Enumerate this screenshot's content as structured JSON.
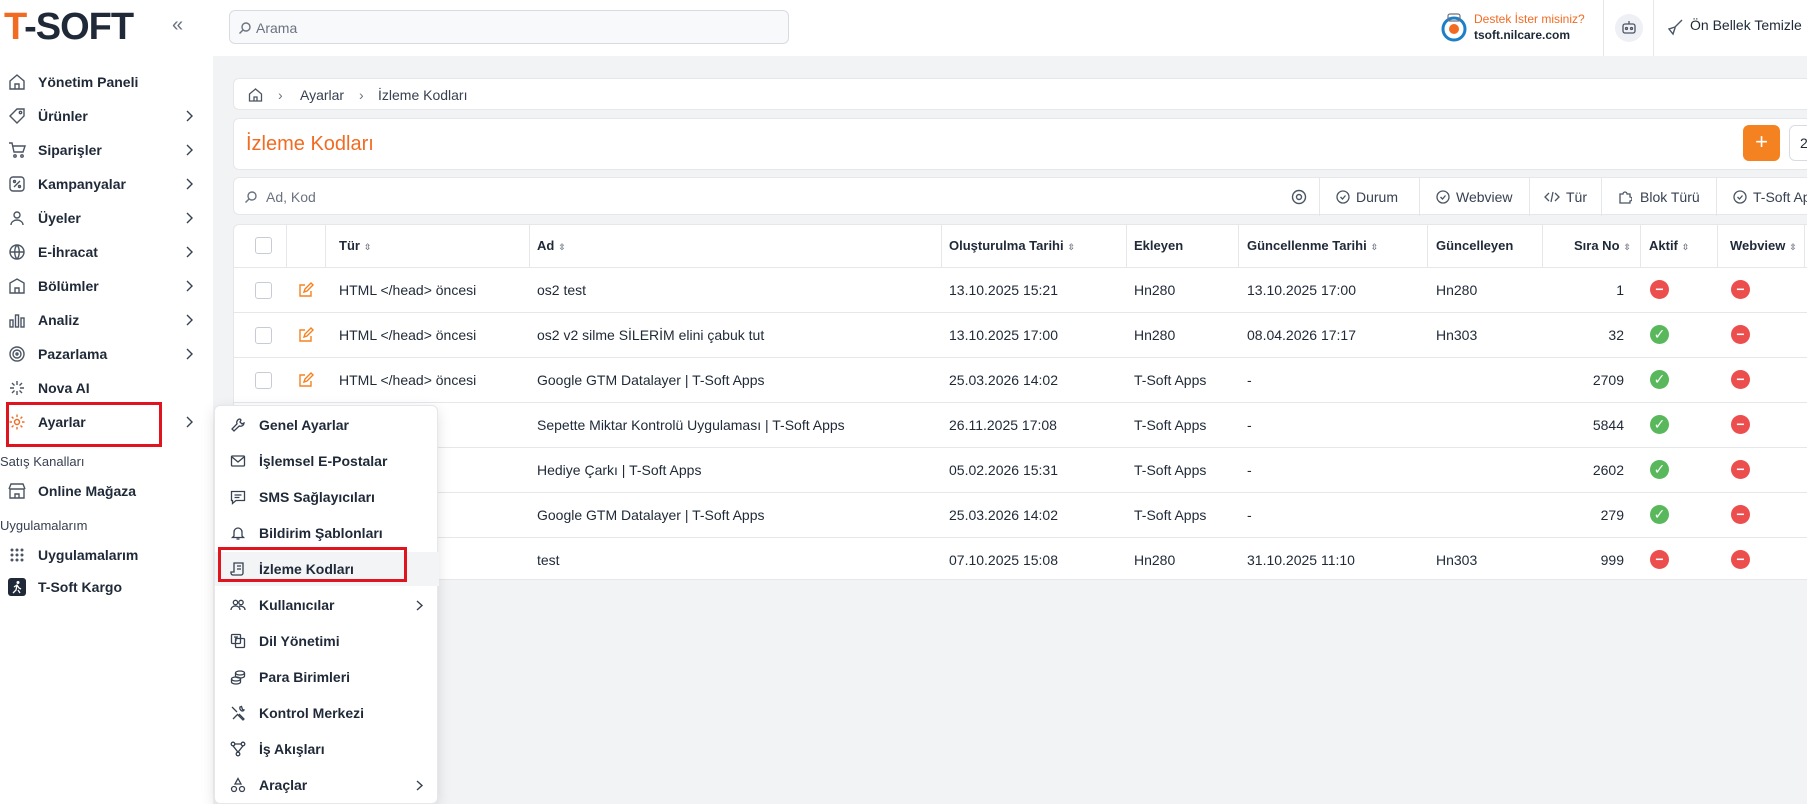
{
  "brand": {
    "logo_first": "T",
    "logo_rest": "-SOFT"
  },
  "sidebar": {
    "items": [
      {
        "label": "Yönetim Paneli"
      },
      {
        "label": "Ürünler"
      },
      {
        "label": "Siparişler"
      },
      {
        "label": "Kampanyalar"
      },
      {
        "label": "Üyeler"
      },
      {
        "label": "E-İhracat"
      },
      {
        "label": "Bölümler"
      },
      {
        "label": "Analiz"
      },
      {
        "label": "Pazarlama"
      },
      {
        "label": "Nova AI"
      },
      {
        "label": "Ayarlar"
      }
    ],
    "sales_channels_heading": "Satış Kanalları",
    "online_store": "Online Mağaza",
    "apps_heading": "Uygulamalarım",
    "my_apps": "Uygulamalarım",
    "tsoft_cargo": "T-Soft Kargo"
  },
  "topbar": {
    "search_placeholder": "Arama",
    "support_title": "Destek İster misiniz?",
    "support_url": "tsoft.nilcare.com",
    "clear_cache": "Ön Bellek Temizle"
  },
  "breadcrumb": {
    "level1": "Ayarlar",
    "level2": "İzleme Kodları"
  },
  "page": {
    "title": "İzleme Kodları",
    "add_label": "+",
    "more_label": "2"
  },
  "filters": {
    "search_placeholder": "Ad, Kod",
    "buttons": [
      "Durum",
      "Webview",
      "Tür",
      "Blok Türü",
      "T-Soft Apps"
    ]
  },
  "table": {
    "headers": {
      "type": "Tür",
      "name": "Ad",
      "created": "Oluşturulma Tarihi",
      "added_by": "Ekleyen",
      "updated": "Güncellenme Tarihi",
      "updated_by": "Güncelleyen",
      "order": "Sıra No",
      "active": "Aktif",
      "webview": "Webview"
    },
    "rows": [
      {
        "type": "HTML </head> öncesi",
        "name": "os2 test",
        "created": "13.10.2025 15:21",
        "added_by": "Hn280",
        "updated": "13.10.2025 17:00",
        "updated_by": "Hn280",
        "order": "1",
        "active": false,
        "webview": false
      },
      {
        "type": "HTML </head> öncesi",
        "name": "os2 v2 silme SİLERİM elini çabuk tut",
        "created": "13.10.2025 17:00",
        "added_by": "Hn280",
        "updated": "08.04.2026 17:17",
        "updated_by": "Hn303",
        "order": "32",
        "active": true,
        "webview": false
      },
      {
        "type": "HTML </head> öncesi",
        "name": "Google GTM Datalayer | T-Soft Apps",
        "created": "25.03.2026 14:02",
        "added_by": "T-Soft Apps",
        "updated": "-",
        "updated_by": "",
        "order": "2709",
        "active": true,
        "webview": false
      },
      {
        "type": "öncesi",
        "name": "Sepette Miktar Kontrolü Uygulaması | T-Soft Apps",
        "created": "26.11.2025 17:08",
        "added_by": "T-Soft Apps",
        "updated": "-",
        "updated_by": "",
        "order": "5844",
        "active": true,
        "webview": false
      },
      {
        "type": "öncesi",
        "name": "Hediye Çarkı | T-Soft Apps",
        "created": "05.02.2026 15:31",
        "added_by": "T-Soft Apps",
        "updated": "-",
        "updated_by": "",
        "order": "2602",
        "active": true,
        "webview": false
      },
      {
        "type": "öncesi",
        "name": "Google GTM Datalayer | T-Soft Apps",
        "created": "25.03.2026 14:02",
        "added_by": "T-Soft Apps",
        "updated": "-",
        "updated_by": "",
        "order": "279",
        "active": true,
        "webview": false
      },
      {
        "type": "",
        "name": "test",
        "created": "07.10.2025 15:08",
        "added_by": "Hn280",
        "updated": "31.10.2025 11:10",
        "updated_by": "Hn303",
        "order": "999",
        "active": false,
        "webview": false
      }
    ]
  },
  "submenu": {
    "items": [
      {
        "label": "Genel Ayarlar",
        "icon": "wrench-icon"
      },
      {
        "label": "İşlemsel E-Postalar",
        "icon": "mail-icon"
      },
      {
        "label": "SMS Sağlayıcıları",
        "icon": "message-icon"
      },
      {
        "label": "Bildirim Şablonları",
        "icon": "bell-icon"
      },
      {
        "label": "İzleme Kodları",
        "icon": "scroll-icon"
      },
      {
        "label": "Kullanıcılar",
        "icon": "users-icon"
      },
      {
        "label": "Dil Yönetimi",
        "icon": "language-icon"
      },
      {
        "label": "Para Birimleri",
        "icon": "coins-icon"
      },
      {
        "label": "Kontrol Merkezi",
        "icon": "tools-icon"
      },
      {
        "label": "İş Akışları",
        "icon": "workflow-icon"
      },
      {
        "label": "Araçlar",
        "icon": "shapes-icon"
      }
    ]
  },
  "colors": {
    "accent": "#f26b22",
    "highlight_box": "#e0141e",
    "active_on": "#5ab85c",
    "active_off": "#ec4d4d"
  }
}
